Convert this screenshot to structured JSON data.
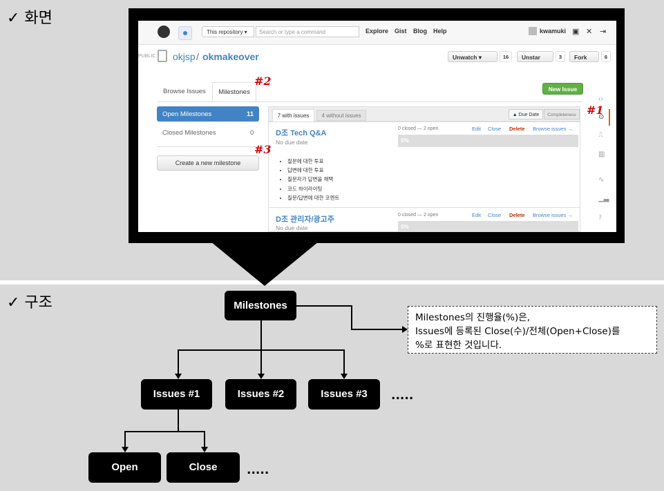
{
  "sections": {
    "screen_title": "✓ 화면",
    "structure_title": "✓ 구조"
  },
  "github": {
    "scope": "This repository ▾",
    "search_placeholder": "Search or type a command",
    "nav": [
      "Explore",
      "Gist",
      "Blog",
      "Help"
    ],
    "user": "kwamuki",
    "public_label": "PUBLIC",
    "repo_owner": "okjsp",
    "repo_name": "okmakeover",
    "watch_label": "Unwatch ▾",
    "watch_count": "16",
    "star_label": "Unstar",
    "star_count": "3",
    "fork_label": "Fork",
    "fork_count": "6",
    "tabs": {
      "browse": "Browse Issues",
      "milestones": "Milestones"
    },
    "new_issue": "New Issue",
    "sidebar": {
      "open_label": "Open Milestones",
      "open_count": "11",
      "closed_label": "Closed Milestones",
      "closed_count": "0",
      "create": "Create a new milestone"
    },
    "list": {
      "tab_with": "7 with issues",
      "tab_without": "4 without issues",
      "sort_due": "▲ Due Date",
      "sort_completeness": "Completeness"
    },
    "milestones": [
      {
        "title": "D조 Tech Q&A",
        "due": "No due date",
        "stat": "0 closed — 2 open",
        "progress": "0%",
        "bullets": [
          "질문에 대한 투표",
          "답변에 대한 투표",
          "질문자가 답변을 채택",
          "코드 하이라이팅",
          "질문/답변에 대한 코멘트"
        ]
      },
      {
        "title": "D조 관리자/광고주",
        "due": "No due date",
        "stat": "0 closed — 2 open",
        "progress": "0%"
      }
    ],
    "actions": {
      "edit": "Edit",
      "close": "Close",
      "delete": "Delete",
      "browse": "Browse issues →"
    }
  },
  "markers": {
    "m1": "#1",
    "m2": "#2",
    "m3": "#3"
  },
  "diagram": {
    "root": "Milestones",
    "issues": [
      "Issues #1",
      "Issues #2",
      "Issues #3"
    ],
    "issue_more": ".....",
    "states": [
      "Open",
      "Close"
    ],
    "state_more": ".....",
    "note_lines": [
      "Milestones의 진행율(%)은,",
      "Issues에 등록된 Close(수)/전체(Open+Close)를",
      "%로 표현한 것입니다."
    ]
  },
  "colors": {
    "accent": "#4183c4",
    "new_issue": "#60b044",
    "delete": "#bd2c00",
    "marker": "#d00000"
  }
}
